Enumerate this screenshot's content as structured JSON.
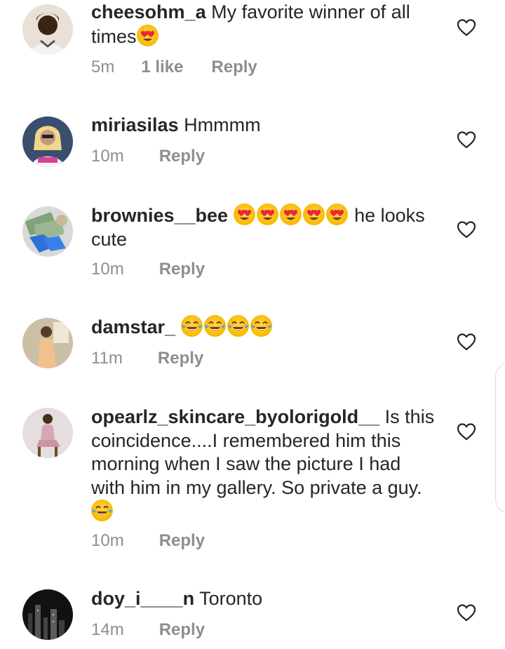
{
  "comments": [
    {
      "username": "cheesohm_a",
      "text": " My favorite winner of all times",
      "emojis": [
        "heart-eyes"
      ],
      "time": "5m",
      "likes": "1 like",
      "reply": "Reply"
    },
    {
      "username": "miriasilas",
      "text": " Hmmmm",
      "emojis": [],
      "time": "10m",
      "likes": "",
      "reply": "Reply"
    },
    {
      "username": "brownies__bee",
      "text_before": " ",
      "emojis": [
        "heart-eyes",
        "heart-eyes",
        "heart-eyes",
        "heart-eyes",
        "heart-eyes"
      ],
      "text": " he looks cute",
      "time": "10m",
      "likes": "",
      "reply": "Reply"
    },
    {
      "username": "damstar_",
      "text": " ",
      "emojis": [
        "tears-of-joy",
        "tears-of-joy",
        "tears-of-joy",
        "tears-of-joy"
      ],
      "time": "11m",
      "likes": "",
      "reply": "Reply"
    },
    {
      "username": "opearlz_skincare_byolorigold__",
      "text": " Is this coincidence....I remembered him this morning when I saw the picture I had with him in my gallery. So private a guy.",
      "emojis": [
        "tears-of-joy"
      ],
      "time": "10m",
      "likes": "",
      "reply": "Reply"
    },
    {
      "username": "doy_i____n",
      "text": " Toronto",
      "emojis": [],
      "time": "14m",
      "likes": "",
      "reply": "Reply"
    }
  ],
  "icons": {
    "like": "heart-outline-icon",
    "emoji_heart_eyes": "heart-eyes-emoji",
    "emoji_laugh": "tears-of-joy-emoji"
  },
  "colors": {
    "text": "#262626",
    "secondary": "#8e8e8e",
    "emoji_face": "#f7b900",
    "emoji_heart": "#e8253a",
    "emoji_tear": "#3fa9f5"
  }
}
